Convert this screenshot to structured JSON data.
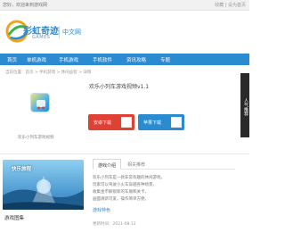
{
  "top_bar": {
    "left_text": "您好，欢迎来到游戏网",
    "right_text": "收藏 | 设为首页"
  },
  "header": {
    "logo_name": "彩虹奇迹",
    "logo_sub": "GAMES",
    "slogan": "中文网"
  },
  "nav": {
    "items": [
      "首页",
      "单机游戏",
      "手机游戏",
      "手机软件",
      "资讯攻略",
      "专题"
    ]
  },
  "breadcrumb": "当前位置：首页 > 手机游戏 > 休闲益智 > 详情",
  "side_tab": "人气推荐",
  "app": {
    "title": "欢乐小列车游戏视频v1.1",
    "caption": "欢乐小列车游戏视频",
    "download_android": "安卓下载",
    "download_ios": "苹果下载"
  },
  "colors": {
    "brand_blue": "#2a8bd1",
    "download_red": "#e04135"
  },
  "banner": {
    "text": "快乐旅程"
  },
  "section_title": "游戏图集",
  "tabs": [
    "游戏介绍",
    "相关推荐"
  ],
  "description": [
    "欢乐小列车是一款非常有趣的休闲游戏，",
    "玩家可以驾驶小火车穿越各种场景，",
    "收集金币解锁新的车厢和关卡，",
    "画面清新可爱，操作简单方便。"
  ],
  "more_link": "游戏特色",
  "bottom_line": "更新时间：2021-08-12"
}
